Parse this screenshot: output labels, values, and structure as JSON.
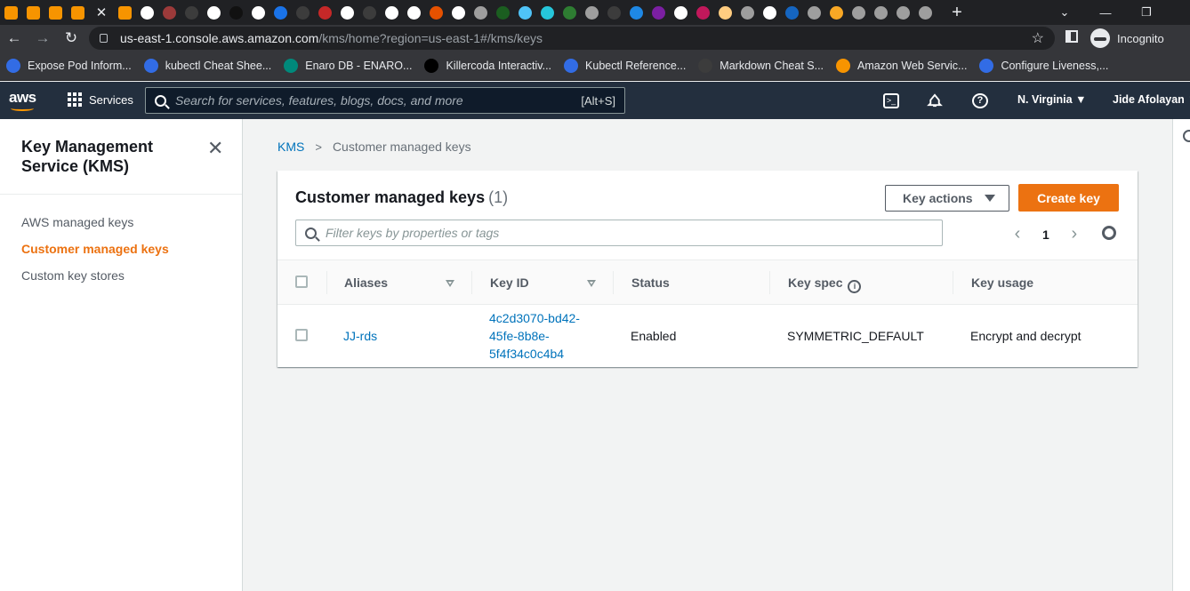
{
  "browser": {
    "tab_icon_colors": [
      "#f79400",
      "#f79400",
      "#f79400",
      "#f79400",
      "#f79400",
      "#ffffff",
      "#9c3a3a",
      "#3c3c3c",
      "#ffffff",
      "#111111",
      "#ffffff",
      "#1a73e8",
      "#3c3c3c",
      "#c62828",
      "#ffffff",
      "#3c3c3c",
      "#ffffff",
      "#ffffff",
      "#e65100",
      "#ffffff",
      "#9e9e9e",
      "#1b5e20",
      "#4fc3f7",
      "#26c6da",
      "#2e7d32",
      "#9e9e9e",
      "#3c3c3c",
      "#1e88e5",
      "#7b1fa2",
      "#ffffff",
      "#c2185b",
      "#ffcc80",
      "#9e9e9e",
      "#ffffff",
      "#1565c0",
      "#9e9e9e",
      "#f9a825",
      "#9e9e9e",
      "#9e9e9e",
      "#9e9e9e",
      "#9e9e9e"
    ],
    "tab_close_icon": "close-icon",
    "new_tab_icon": "plus-icon",
    "url_host": "us-east-1.console.aws.amazon.com",
    "url_path": "/kms/home?region=us-east-1#/kms/keys",
    "incognito_label": "Incognito",
    "bookmarks": [
      {
        "label": "Expose Pod Inform...",
        "color": "#326ce5"
      },
      {
        "label": "kubectl Cheat Shee...",
        "color": "#326ce5"
      },
      {
        "label": "Enaro DB - ENARO...",
        "color": "#00897b"
      },
      {
        "label": "Killercoda Interactiv...",
        "color": "#000000"
      },
      {
        "label": "Kubectl Reference...",
        "color": "#326ce5"
      },
      {
        "label": "Markdown Cheat S...",
        "color": "#3c3c3c"
      },
      {
        "label": "Amazon Web Servic...",
        "color": "#f79400"
      },
      {
        "label": "Configure Liveness,...",
        "color": "#326ce5"
      }
    ]
  },
  "aws_header": {
    "logo": "aws",
    "services_label": "Services",
    "search_placeholder": "Search for services, features, blogs, docs, and more",
    "search_shortcut": "[Alt+S]",
    "region": "N. Virginia ▼",
    "account": "Jide Afolayan ▼",
    "accent": "#ff9900"
  },
  "sidenav": {
    "title": "Key Management Service (KMS)",
    "items": [
      {
        "label": "AWS managed keys",
        "active": false
      },
      {
        "label": "Customer managed keys",
        "active": true
      },
      {
        "label": "Custom key stores",
        "active": false
      }
    ]
  },
  "breadcrumb": {
    "root": "KMS",
    "current": "Customer managed keys"
  },
  "keys_table": {
    "title": "Customer managed keys",
    "count": "(1)",
    "actions_label": "Key actions",
    "create_label": "Create key",
    "filter_placeholder": "Filter keys by properties or tags",
    "page": "1",
    "columns": [
      "Aliases",
      "Key ID",
      "Status",
      "Key spec",
      "Key usage"
    ],
    "rows": [
      {
        "alias": "JJ-rds",
        "key_id_lines": [
          "4c2d3070-bd42-",
          "45fe-8b8e-",
          "5f4f34c0c4b4"
        ],
        "status": "Enabled",
        "key_spec": "SYMMETRIC_DEFAULT",
        "key_usage": "Encrypt and decrypt"
      }
    ]
  },
  "colors": {
    "primary_orange": "#ec7211",
    "link_blue": "#0073bb",
    "nav_dark": "#232f3e"
  }
}
